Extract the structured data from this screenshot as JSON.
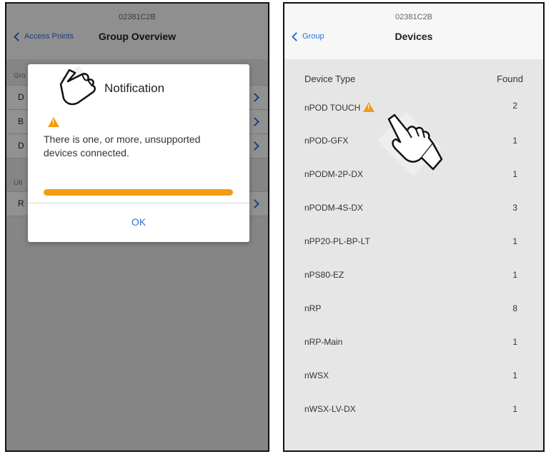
{
  "left_screen": {
    "nav": {
      "subtitle": "02381C2B",
      "title": "Group Overview",
      "back_label": "Access Points"
    },
    "underlying": {
      "section_1": "Gro",
      "rows_1": [
        "D",
        "B",
        "D"
      ],
      "section_2": "Uti",
      "rows_2": [
        "R"
      ]
    },
    "dialog": {
      "title": "Notification",
      "message": "There is one, or more, unsupported devices connected.",
      "ok_label": "OK"
    }
  },
  "right_screen": {
    "nav": {
      "subtitle": "02381C2B",
      "title": "Devices",
      "back_label": "Group"
    },
    "headers": {
      "type": "Device Type",
      "found": "Found"
    },
    "devices": [
      {
        "name": "nPOD TOUCH",
        "count": "2",
        "warning": true
      },
      {
        "name": "nPOD-GFX",
        "count": "1"
      },
      {
        "name": "nPODM-2P-DX",
        "count": "1"
      },
      {
        "name": "nPODM-4S-DX",
        "count": "3"
      },
      {
        "name": "nPP20-PL-BP-LT",
        "count": "1"
      },
      {
        "name": "nPS80-EZ",
        "count": "1"
      },
      {
        "name": "nRP",
        "count": "8"
      },
      {
        "name": "nRP-Main",
        "count": "1"
      },
      {
        "name": "nWSX",
        "count": "1"
      },
      {
        "name": "nWSX-LV-DX",
        "count": "1"
      }
    ]
  },
  "colors": {
    "accent": "#2b6fd6",
    "warning": "#f39c12"
  },
  "icons": {
    "warning": "warning-triangle-icon",
    "pointer": "pointing-hand-icon"
  }
}
